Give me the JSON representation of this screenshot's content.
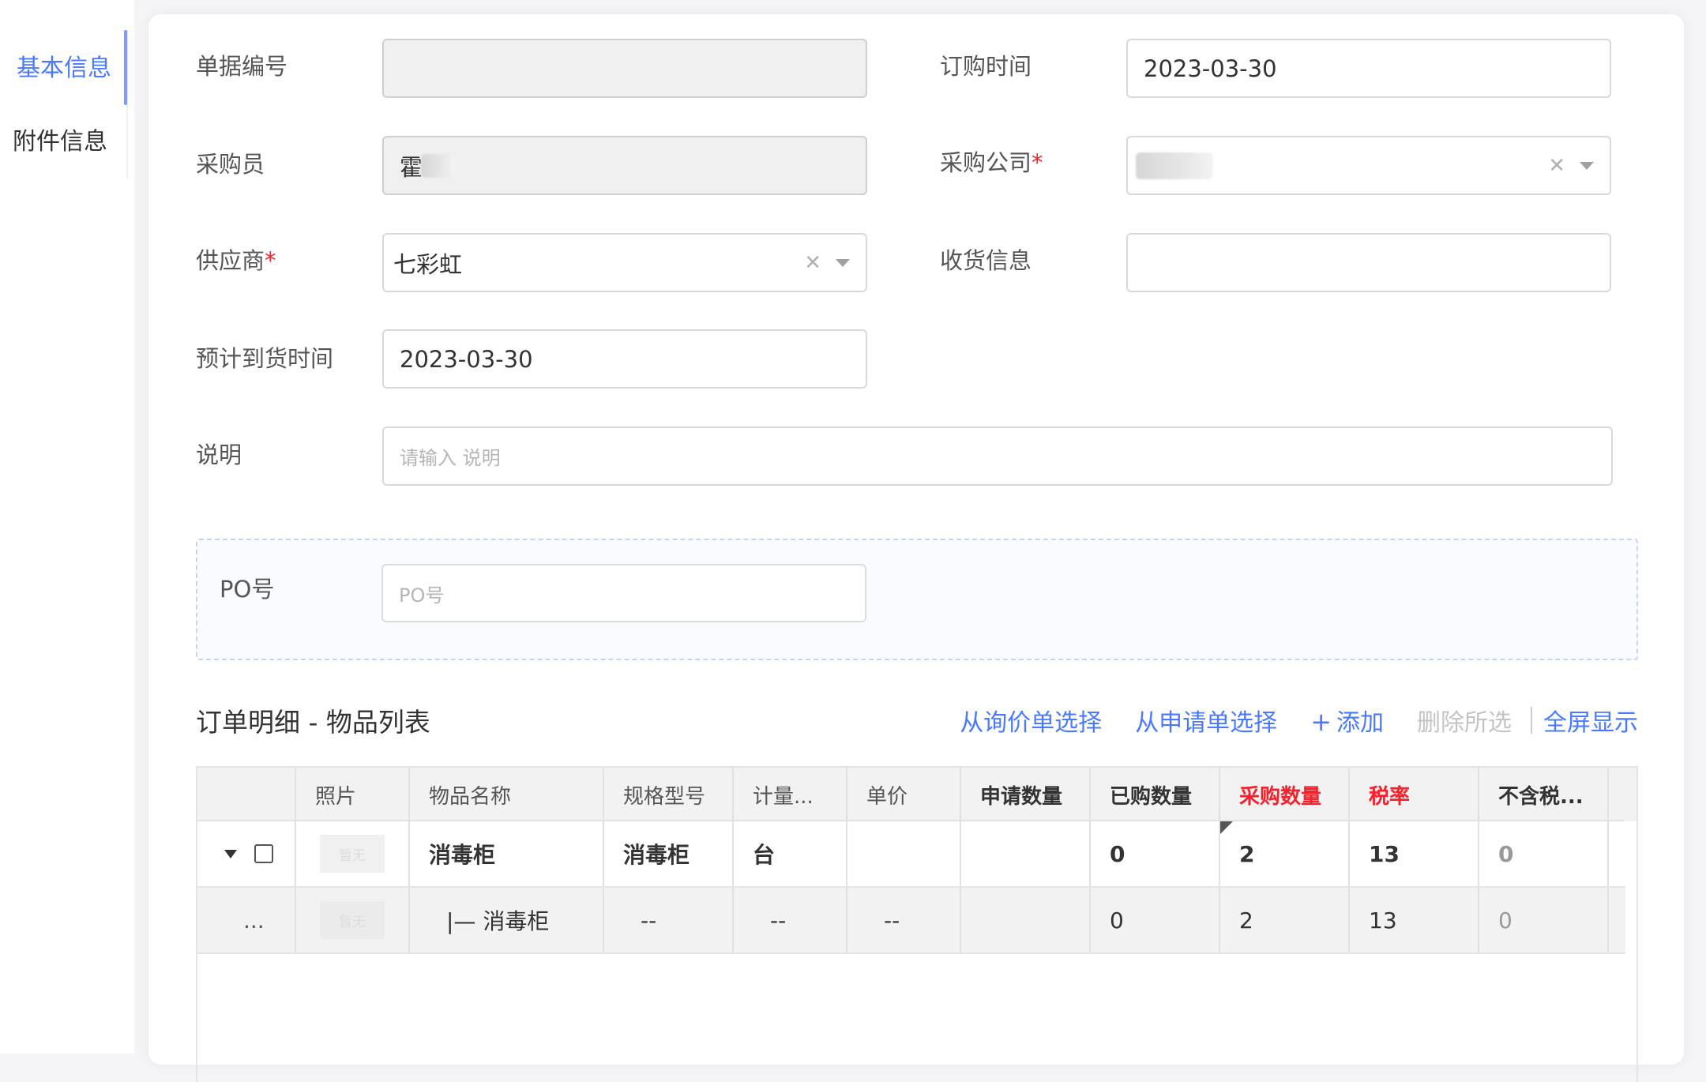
{
  "sidebar": {
    "items": [
      {
        "label": "基本信息",
        "active": true
      },
      {
        "label": "附件信息",
        "active": false
      }
    ]
  },
  "form": {
    "doc_no": {
      "label": "单据编号",
      "value": ""
    },
    "order_time": {
      "label": "订购时间",
      "value": "2023-03-30"
    },
    "buyer": {
      "label": "采购员",
      "value": "霍"
    },
    "company": {
      "label": "采购公司",
      "required_mark": "*",
      "value": ""
    },
    "supplier": {
      "label": "供应商",
      "required_mark": "*",
      "value": "七彩虹"
    },
    "receipt": {
      "label": "收货信息",
      "value": ""
    },
    "eta": {
      "label": "预计到货时间",
      "value": "2023-03-30"
    },
    "note": {
      "label": "说明",
      "placeholder": "请输入 说明"
    },
    "po": {
      "label": "PO号",
      "placeholder": "PO号"
    }
  },
  "detail": {
    "title": "订单明细 - 物品列表",
    "actions": {
      "from_inquiry": "从询价单选择",
      "from_request": "从申请单选择",
      "add_icon": "+",
      "add": "添加",
      "delete_selected": "删除所选",
      "fullscreen": "全屏显示"
    },
    "columns": [
      "",
      "照片",
      "物品名称",
      "规格型号",
      "计量...",
      "单价",
      "申请数量",
      "已购数量",
      "采购数量",
      "税率",
      "不含税..."
    ],
    "rows": [
      {
        "photo": "暂无",
        "name": "消毒柜",
        "spec": "消毒柜",
        "unit": "台",
        "price": "",
        "requested": "",
        "purchased": "0",
        "qty": "2",
        "tax": "13",
        "excl_tax": "0"
      },
      {
        "lead": "...",
        "photo": "暂无",
        "name": "|— 消毒柜",
        "spec": "--",
        "unit": "--",
        "price": "--",
        "requested": "",
        "purchased": "0",
        "qty": "2",
        "tax": "13",
        "excl_tax": "0"
      }
    ]
  },
  "colors": {
    "accent": "#4a79ff",
    "required": "#f5222d"
  }
}
